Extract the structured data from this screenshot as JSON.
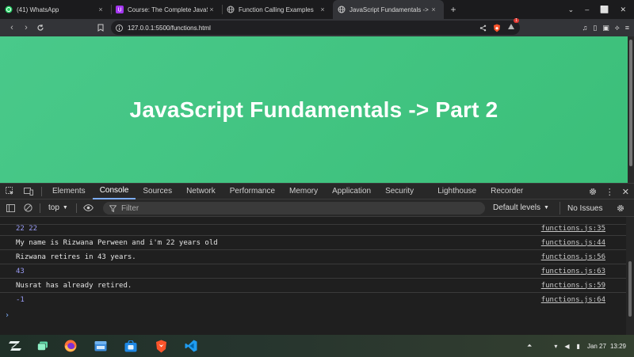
{
  "browser": {
    "tabs": [
      {
        "title": "(41) WhatsApp",
        "icon": "whatsapp-icon",
        "active": false
      },
      {
        "title": "Course: The Complete JavaScri",
        "icon": "course-icon",
        "active": false
      },
      {
        "title": "Function Calling Examples",
        "icon": "globe-icon",
        "active": false
      },
      {
        "title": "JavaScript Fundamentals ->",
        "icon": "globe-icon",
        "active": true
      }
    ],
    "tab_close_glyph": "×",
    "new_tab_glyph": "+",
    "url": "127.0.0.1:5500/functions.html",
    "brave_rewards_badge": "1"
  },
  "page": {
    "heading": "JavaScript Fundamentals -> Part 2",
    "background_color": "#43c584"
  },
  "devtools": {
    "tabs": [
      "Elements",
      "Console",
      "Sources",
      "Network",
      "Performance",
      "Memory",
      "Application",
      "Security",
      "Lighthouse",
      "Recorder"
    ],
    "active_tab": "Console",
    "context": "top",
    "filter_placeholder": "Filter",
    "levels_label": "Default levels",
    "issues_label": "No Issues",
    "console_lines": [
      {
        "text": "22 22",
        "source": "functions.js:35",
        "kind": "num"
      },
      {
        "text": "My name is Rizwana Perween and i'm 22 years old",
        "source": "functions.js:44",
        "kind": "txt"
      },
      {
        "text": "Rizwana retires in 43 years.",
        "source": "functions.js:56",
        "kind": "txt"
      },
      {
        "text": "43",
        "source": "functions.js:63",
        "kind": "num"
      },
      {
        "text": "Nusrat has already retired.",
        "source": "functions.js:59",
        "kind": "txt"
      },
      {
        "text": "-1",
        "source": "functions.js:64",
        "kind": "num"
      }
    ],
    "prompt_glyph": "›"
  },
  "taskbar": {
    "apps": [
      "zorin-menu-icon",
      "workspaces-icon",
      "firefox-icon",
      "files-icon",
      "software-store-icon",
      "brave-icon",
      "vscode-icon"
    ],
    "date": "Jan 27",
    "time": "13:29"
  }
}
